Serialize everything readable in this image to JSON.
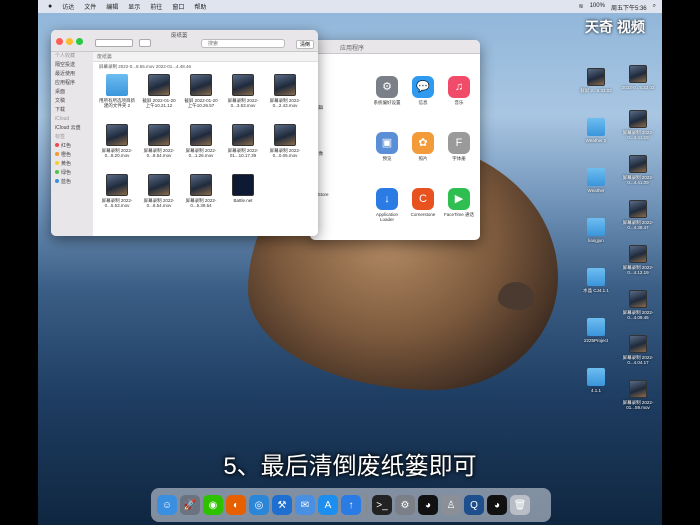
{
  "menubar": {
    "items": [
      "访达",
      "文件",
      "编辑",
      "显示",
      "前往",
      "窗口",
      "帮助"
    ],
    "status": [
      "100%",
      "周五下午5:36"
    ]
  },
  "finder": {
    "title": "废纸篓",
    "location": "废纸篓",
    "search_placeholder": "搜索",
    "empty_label": "清倒",
    "top_row_text": "屏幕录制 2022-0...8.55.mov  2022-01...4.48.46",
    "sidebar": [
      "个人收藏",
      "隔空投送",
      "最近使用",
      "应用程序",
      "桌面",
      "文稿",
      "下载",
      "iCloud",
      "iCloud 云盘",
      "标签",
      "红色",
      "橙色",
      "黄色",
      "绿色",
      "蓝色"
    ],
    "files": [
      {
        "name": "用所有所选项目新建的文件夹 2",
        "kind": "folder"
      },
      {
        "name": "截屏 2022-01-20 上午10.21.12",
        "kind": "mov"
      },
      {
        "name": "截屏 2022-01-20 上午10.26.57",
        "kind": "mov"
      },
      {
        "name": "屏幕录制 2022-0...3.53.mov",
        "kind": "mov"
      },
      {
        "name": "屏幕录制 2022-0...2.43.mov",
        "kind": "mov"
      },
      {
        "name": "屏幕录制 2022-0...8.20.mov",
        "kind": "mov"
      },
      {
        "name": "屏幕录制 2022-0...8.54.mov",
        "kind": "mov"
      },
      {
        "name": "屏幕录制 2022-0...1.26.mov",
        "kind": "mov"
      },
      {
        "name": "屏幕录制 2022-01...10.17.39",
        "kind": "mov"
      },
      {
        "name": "屏幕录制 2022-0...0.06.mov",
        "kind": "mov"
      },
      {
        "name": "屏幕录制 2022-0...5.53.mov",
        "kind": "mov"
      },
      {
        "name": "屏幕录制 2022-0...8.54.mov",
        "kind": "mov"
      },
      {
        "name": "屏幕录制 2022-0...5.39.54",
        "kind": "mov"
      },
      {
        "name": "Battle.net",
        "kind": "app"
      }
    ]
  },
  "apps_window": {
    "title": "应用程序",
    "apps": [
      {
        "name": "系统偏好设置",
        "glyph": "⚙",
        "color": "#7b7f87"
      },
      {
        "name": "信息",
        "glyph": "💬",
        "color": "#2e9bf0"
      },
      {
        "name": "音乐",
        "glyph": "♫",
        "color": "#f04c6a"
      },
      {
        "name": "预览",
        "glyph": "▣",
        "color": "#5a8ed6"
      },
      {
        "name": "照片",
        "glyph": "✿",
        "color": "#f29b38"
      },
      {
        "name": "字体册",
        "glyph": "F",
        "color": "#9a9a9a"
      },
      {
        "name": "Application Loader",
        "glyph": "↓",
        "color": "#2b7be4"
      },
      {
        "name": "Cornerstone",
        "glyph": "C",
        "color": "#e8521f"
      },
      {
        "name": "FaceTime 通话",
        "glyph": "▶",
        "color": "#2fbf50"
      }
    ],
    "left_labels": [
      "编辑",
      "录像",
      "e Store"
    ]
  },
  "desktop": {
    "left_icons": [
      {
        "name": "截屏 2...5.33.02",
        "kind": "mov"
      },
      {
        "name": "Weather 2",
        "kind": "folder"
      },
      {
        "name": "Weather",
        "kind": "folder"
      },
      {
        "name": "liangjun",
        "kind": "folder"
      },
      {
        "name": "水晶 CJ4.1.1",
        "kind": "folder"
      },
      {
        "name": "2225Project",
        "kind": "folder"
      },
      {
        "name": "4.1.1",
        "kind": "folder"
      }
    ],
    "right_icons": [
      {
        "name": "2022-0...5.33.02",
        "kind": "mov"
      },
      {
        "name": "屏幕录制 2022-0...4.41.19",
        "kind": "mov"
      },
      {
        "name": "屏幕录制 2022-0...4.41.09",
        "kind": "mov"
      },
      {
        "name": "屏幕录制 2022-0...4.38.47",
        "kind": "mov"
      },
      {
        "name": "屏幕录制 2022-0...4.12.19",
        "kind": "mov"
      },
      {
        "name": "屏幕录制 2022-0...4.09.45",
        "kind": "mov"
      },
      {
        "name": "屏幕录制 2022-0...4.04.17",
        "kind": "mov"
      },
      {
        "name": "屏幕录制 2022-01...59.mov",
        "kind": "mov"
      }
    ]
  },
  "subtitle": "5、最后清倒废纸篓即可",
  "watermark": "天奇 视频",
  "dock": [
    {
      "name": "finder-dock-icon",
      "glyph": "☺",
      "color": "#3a8fe0"
    },
    {
      "name": "launchpad-dock-icon",
      "glyph": "🚀",
      "color": "#6b7280"
    },
    {
      "name": "wechat-dock-icon",
      "glyph": "◉",
      "color": "#2dc100"
    },
    {
      "name": "firefox-dock-icon",
      "glyph": "◐",
      "color": "#e66000"
    },
    {
      "name": "safari-dock-icon",
      "glyph": "◎",
      "color": "#2c86d8"
    },
    {
      "name": "xcode-dock-icon",
      "glyph": "⚒",
      "color": "#1f6fd1"
    },
    {
      "name": "mail-dock-icon",
      "glyph": "✉",
      "color": "#4a90e2"
    },
    {
      "name": "appstore-dock-icon",
      "glyph": "A",
      "color": "#1c8ef0"
    },
    {
      "name": "app-loader-dock-icon",
      "glyph": "↑",
      "color": "#2b7be4"
    },
    {
      "name": "terminal-dock-icon",
      "glyph": ">_",
      "color": "#222222"
    },
    {
      "name": "system-prefs-dock-icon",
      "glyph": "⚙",
      "color": "#7b7f87"
    },
    {
      "name": "qq-dock-icon",
      "glyph": "◕",
      "color": "#111111"
    },
    {
      "name": "instruments-dock-icon",
      "glyph": "♙",
      "color": "#8a8f98"
    },
    {
      "name": "quicktime-dock-icon",
      "glyph": "Q",
      "color": "#1d4f8c"
    },
    {
      "name": "qq-second-dock-icon",
      "glyph": "◕",
      "color": "#111111"
    },
    {
      "name": "trash-dock-icon",
      "glyph": "🗑",
      "color": "#b9bec6"
    }
  ]
}
